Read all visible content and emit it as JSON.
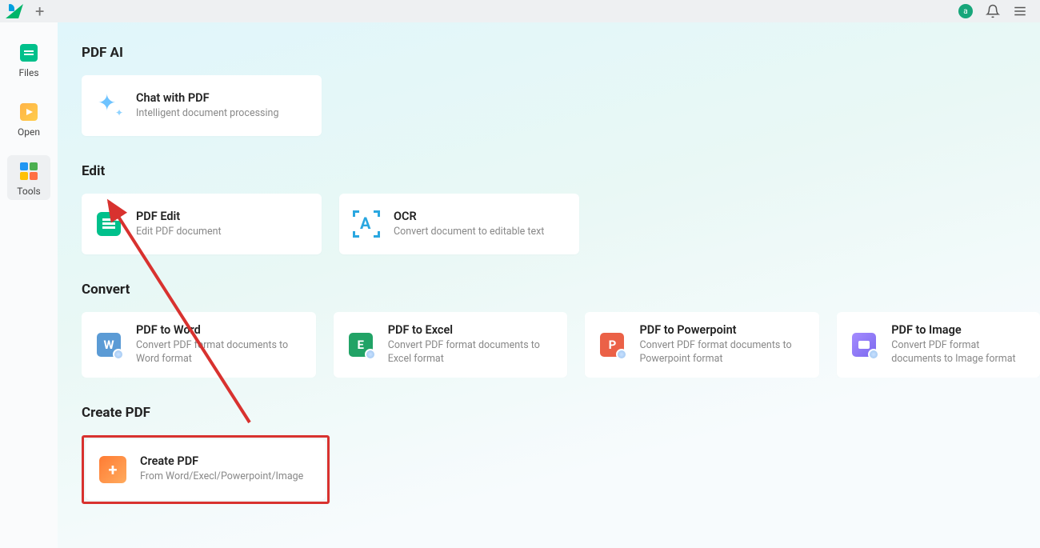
{
  "titlebar": {
    "avatar_letter": "a"
  },
  "sidebar": {
    "items": [
      {
        "label": "Files"
      },
      {
        "label": "Open"
      },
      {
        "label": "Tools"
      }
    ]
  },
  "sections": {
    "pdf_ai": {
      "heading": "PDF AI",
      "cards": [
        {
          "title": "Chat with PDF",
          "subtitle": "Intelligent document processing"
        }
      ]
    },
    "edit": {
      "heading": "Edit",
      "cards": [
        {
          "title": "PDF Edit",
          "subtitle": "Edit PDF document"
        },
        {
          "title": "OCR",
          "subtitle": "Convert document to editable text"
        }
      ]
    },
    "convert": {
      "heading": "Convert",
      "cards": [
        {
          "title": "PDF to Word",
          "subtitle": "Convert PDF format documents to Word format"
        },
        {
          "title": "PDF to Excel",
          "subtitle": "Convert PDF format documents to Excel format"
        },
        {
          "title": "PDF to Powerpoint",
          "subtitle": "Convert PDF format documents to Powerpoint format"
        },
        {
          "title": "PDF to Image",
          "subtitle": "Convert PDF format documents to Image format"
        }
      ]
    },
    "create_pdf": {
      "heading": "Create PDF",
      "cards": [
        {
          "title": "Create PDF",
          "subtitle": "From Word/Execl/Powerpoint/Image"
        }
      ]
    }
  },
  "annotation": {
    "arrow_color": "#d8322f",
    "highlight_color": "#d8322f"
  }
}
